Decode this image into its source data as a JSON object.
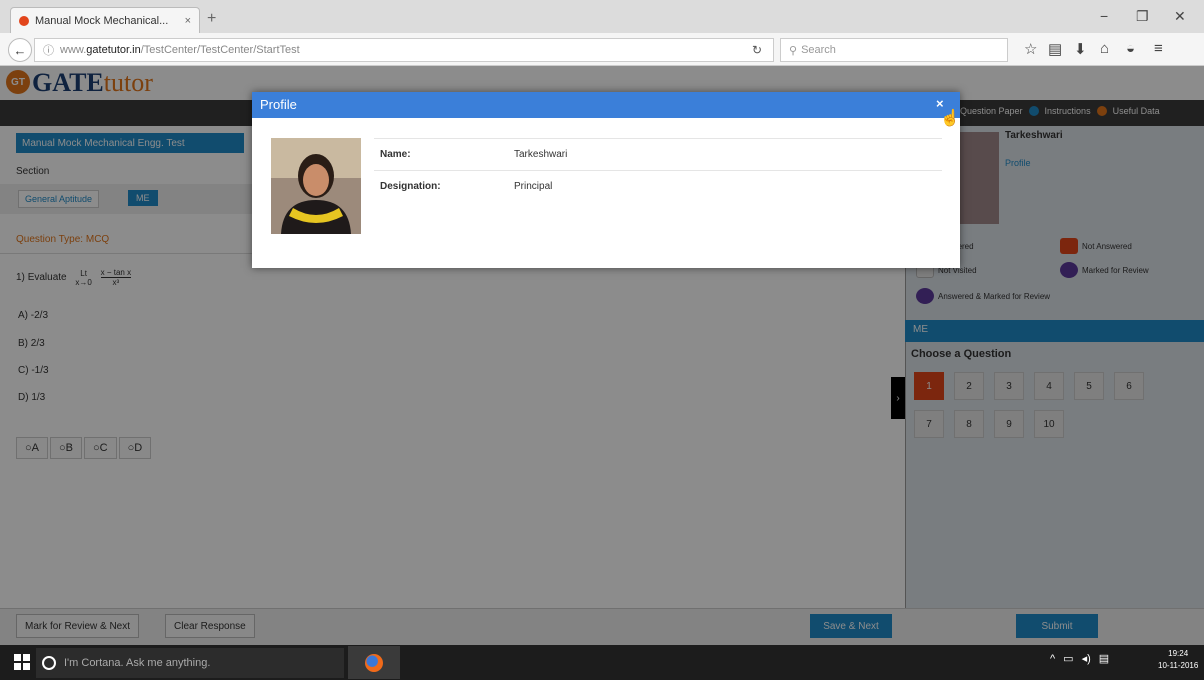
{
  "browser": {
    "tab_title": "Manual Mock Mechanical...",
    "url_prefix": "www.",
    "url_domain": "gatetutor.in",
    "url_path": "/TestCenter/TestCenter/StartTest",
    "search_placeholder": "Search"
  },
  "logo": {
    "mark": "GT",
    "word1": "GATE",
    "word2": "tutor"
  },
  "header_links": [
    "Question Paper",
    "Instructions",
    "Useful Data"
  ],
  "test_name": "Manual Mock Mechanical Engg. Test",
  "section_label": "Section",
  "sections": [
    "General Aptitude",
    "ME"
  ],
  "question_type": "Question Type: MCQ",
  "question": {
    "number": "1)",
    "prefix": "Evaluate",
    "limit": "Lt",
    "limit_sub": "x→0",
    "numerator": "x − tan x",
    "denominator": "x³"
  },
  "options": [
    "A) -2/3",
    "B) 2/3",
    "C) -1/3",
    "D) 1/3"
  ],
  "answer_radios": [
    "A",
    "B",
    "C",
    "D"
  ],
  "buttons": {
    "mark_review": "Mark for Review & Next",
    "clear": "Clear Response",
    "save_next": "Save & Next",
    "submit": "Submit"
  },
  "right_panel": {
    "name": "Tarkeshwari",
    "profile_link": "Profile",
    "legend": [
      {
        "label": "Answered",
        "color": "#3fa34d"
      },
      {
        "label": "Not Answered",
        "color": "#e2451b"
      },
      {
        "label": "Not Visited",
        "color": "#e8e8e8"
      },
      {
        "label": "Marked for Review",
        "color": "#5b3a9b"
      },
      {
        "label": "Answered & Marked for Review",
        "color": "#5b3a9b"
      }
    ],
    "section_title": "ME",
    "choose": "Choose a Question",
    "questions": [
      "1",
      "2",
      "3",
      "4",
      "5",
      "6",
      "7",
      "8",
      "9",
      "10"
    ]
  },
  "modal": {
    "title": "Profile",
    "close": "×",
    "fields": [
      {
        "label": "Name:",
        "value": "Tarkeshwari"
      },
      {
        "label": "Designation:",
        "value": "Principal"
      }
    ]
  },
  "taskbar": {
    "cortana": "I'm Cortana. Ask me anything.",
    "time": "19:24",
    "date": "10-11-2016"
  }
}
